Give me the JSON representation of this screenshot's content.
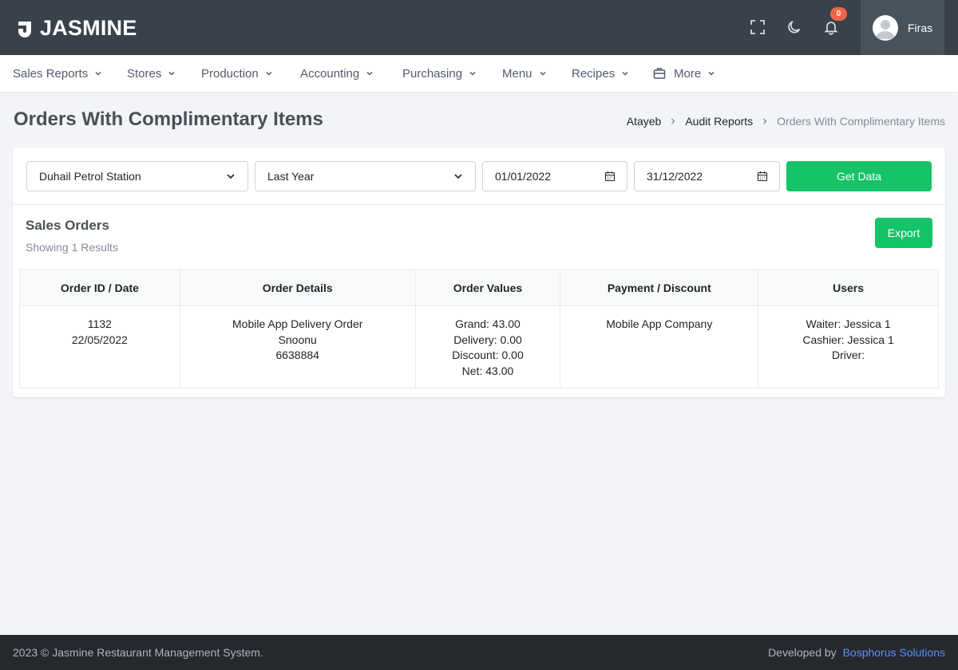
{
  "app": {
    "brand": "JASMINE"
  },
  "topbar": {
    "icons": [
      "fullscreen-icon",
      "moon-icon",
      "bell-icon"
    ],
    "notification_count": "0",
    "user_name": "Firas"
  },
  "nav": {
    "items": [
      {
        "label": "Sales Reports"
      },
      {
        "label": "Stores"
      },
      {
        "label": "Production"
      },
      {
        "label": "Accounting"
      },
      {
        "label": "Purchasing"
      },
      {
        "label": "Menu"
      },
      {
        "label": "Recipes"
      },
      {
        "label": "More",
        "icon": "briefcase-icon"
      }
    ]
  },
  "page": {
    "title": "Orders With Complimentary Items",
    "breadcrumb": [
      "Atayeb",
      "Audit Reports",
      "Orders With Complimentary Items"
    ]
  },
  "filters": {
    "store": "Duhail Petrol Station",
    "period": "Last Year",
    "date_from": "01/01/2022",
    "date_to": "31/12/2022",
    "get_data_label": "Get Data"
  },
  "section": {
    "title": "Sales Orders",
    "subtitle": "Showing 1 Results",
    "export_label": "Export"
  },
  "table": {
    "headers": [
      "Order ID / Date",
      "Order Details",
      "Order Values",
      "Payment / Discount",
      "Users"
    ],
    "rows": [
      {
        "order_id": "1132",
        "date": "22/05/2022",
        "details": [
          "Mobile App Delivery Order",
          "Snoonu",
          "6638884"
        ],
        "values": [
          "Grand: 43.00",
          "Delivery: 0.00",
          "Discount: 0.00",
          "Net: 43.00"
        ],
        "payment": "Mobile App Company",
        "users": [
          "Waiter: Jessica 1",
          "Cashier: Jessica 1",
          "Driver:"
        ]
      }
    ]
  },
  "footer": {
    "copyright": "2023 © Jasmine Restaurant Management System.",
    "developed_by": "Developed by",
    "developer": "Bosphorus Solutions"
  },
  "colors": {
    "topbar": "#39424a",
    "accent_green": "#15c468",
    "badge_red": "#f06548",
    "footer": "#25292d",
    "link_blue": "#5c8df6"
  }
}
